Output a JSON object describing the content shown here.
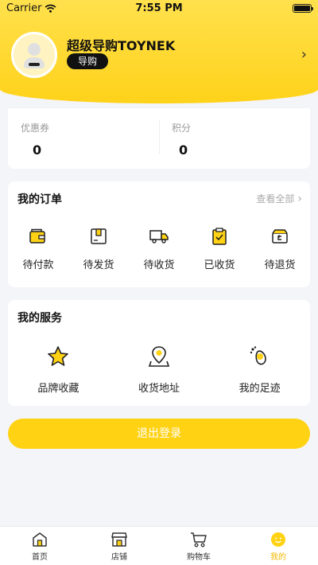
{
  "status_bar": {
    "carrier": "Carrier",
    "time": "7:55 PM"
  },
  "profile": {
    "name": "超级导购TOYNEK",
    "role": "导购"
  },
  "stats": [
    {
      "label": "优惠券",
      "value": "0"
    },
    {
      "label": "积分",
      "value": "0"
    }
  ],
  "orders": {
    "title": "我的订单",
    "view_all": "查看全部",
    "items": [
      {
        "label": "待付款",
        "icon": "wallet-icon"
      },
      {
        "label": "待发货",
        "icon": "package-icon"
      },
      {
        "label": "待收货",
        "icon": "truck-icon"
      },
      {
        "label": "已收货",
        "icon": "clipboard-check-icon"
      },
      {
        "label": "待退货",
        "icon": "return-box-icon"
      }
    ]
  },
  "services": {
    "title": "我的服务",
    "items": [
      {
        "label": "品牌收藏",
        "icon": "star-icon"
      },
      {
        "label": "收货地址",
        "icon": "location-pin-icon"
      },
      {
        "label": "我的足迹",
        "icon": "footprint-icon"
      }
    ]
  },
  "logout": "退出登录",
  "tabbar": {
    "items": [
      {
        "label": "首页",
        "icon": "home-icon",
        "active": false
      },
      {
        "label": "店铺",
        "icon": "store-icon",
        "active": false
      },
      {
        "label": "购物车",
        "icon": "cart-icon",
        "active": false
      },
      {
        "label": "我的",
        "icon": "smiley-icon",
        "active": true
      }
    ]
  },
  "colors": {
    "accent": "#ffd214",
    "accent_light": "#ffe14d",
    "active_tab": "#f0b800"
  }
}
